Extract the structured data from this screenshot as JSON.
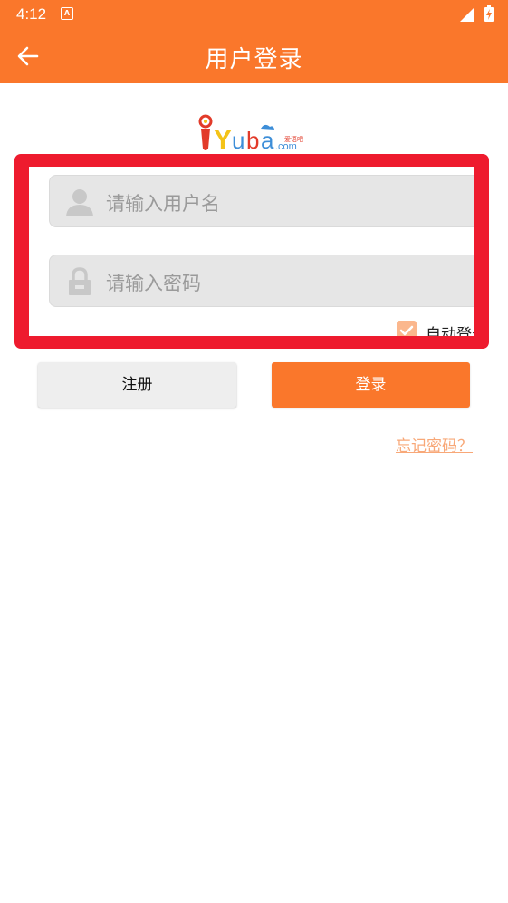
{
  "status_bar": {
    "time": "4:12",
    "notification_badge": "A"
  },
  "app_bar": {
    "title": "用户登录",
    "back_icon": "arrow-left-icon"
  },
  "logo": {
    "brand": "iYuba",
    "tagline": "爱语吧",
    "domain": ".com"
  },
  "form": {
    "username_placeholder": "请输入用户名",
    "password_placeholder": "请输入密码",
    "auto_login_label": "自动登录",
    "auto_login_checked": true
  },
  "buttons": {
    "register": "注册",
    "login": "登录"
  },
  "links": {
    "forgot_password": "忘记密码？"
  },
  "colors": {
    "primary": "#FA772B",
    "highlight": "#EE1B2E",
    "field_bg": "#E6E6E6",
    "link": "#F8A878"
  }
}
